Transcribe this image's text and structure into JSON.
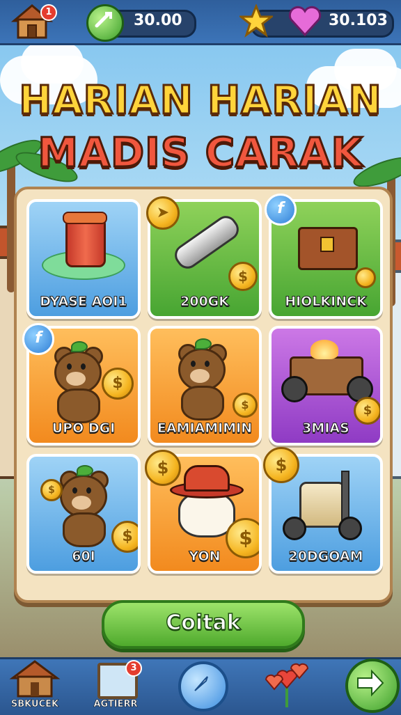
{
  "topbar": {
    "home_badge": "1",
    "currency_1": "30.00",
    "currency_2": "30.103"
  },
  "title": {
    "line1": "HARIAN HARIAN",
    "line2": "MADIS CARAK"
  },
  "grid": {
    "items": [
      {
        "label": "DYASE AOI1",
        "color": "blue"
      },
      {
        "label": "200GK",
        "color": "green"
      },
      {
        "label": "HIOLKINCK",
        "color": "green"
      },
      {
        "label": "UPO DGI",
        "color": "orange"
      },
      {
        "label": "EAMIAMIMIN",
        "color": "orange"
      },
      {
        "label": "3MIAS",
        "color": "purple"
      },
      {
        "label": "60I",
        "color": "blue"
      },
      {
        "label": "YON",
        "color": "orange"
      },
      {
        "label": "20DGOAM",
        "color": "blue"
      }
    ]
  },
  "collect_button": {
    "label": "Coitak"
  },
  "bottom_nav": {
    "item1_label": "SBKUCEK",
    "item2_label": "AGTIERR",
    "item2_badge": "3"
  },
  "colors": {
    "title_yellow": "#ffd43b",
    "title_red": "#f0573e",
    "collect_green": "#4faa2d",
    "topbar_blue": "#3c74b8"
  }
}
